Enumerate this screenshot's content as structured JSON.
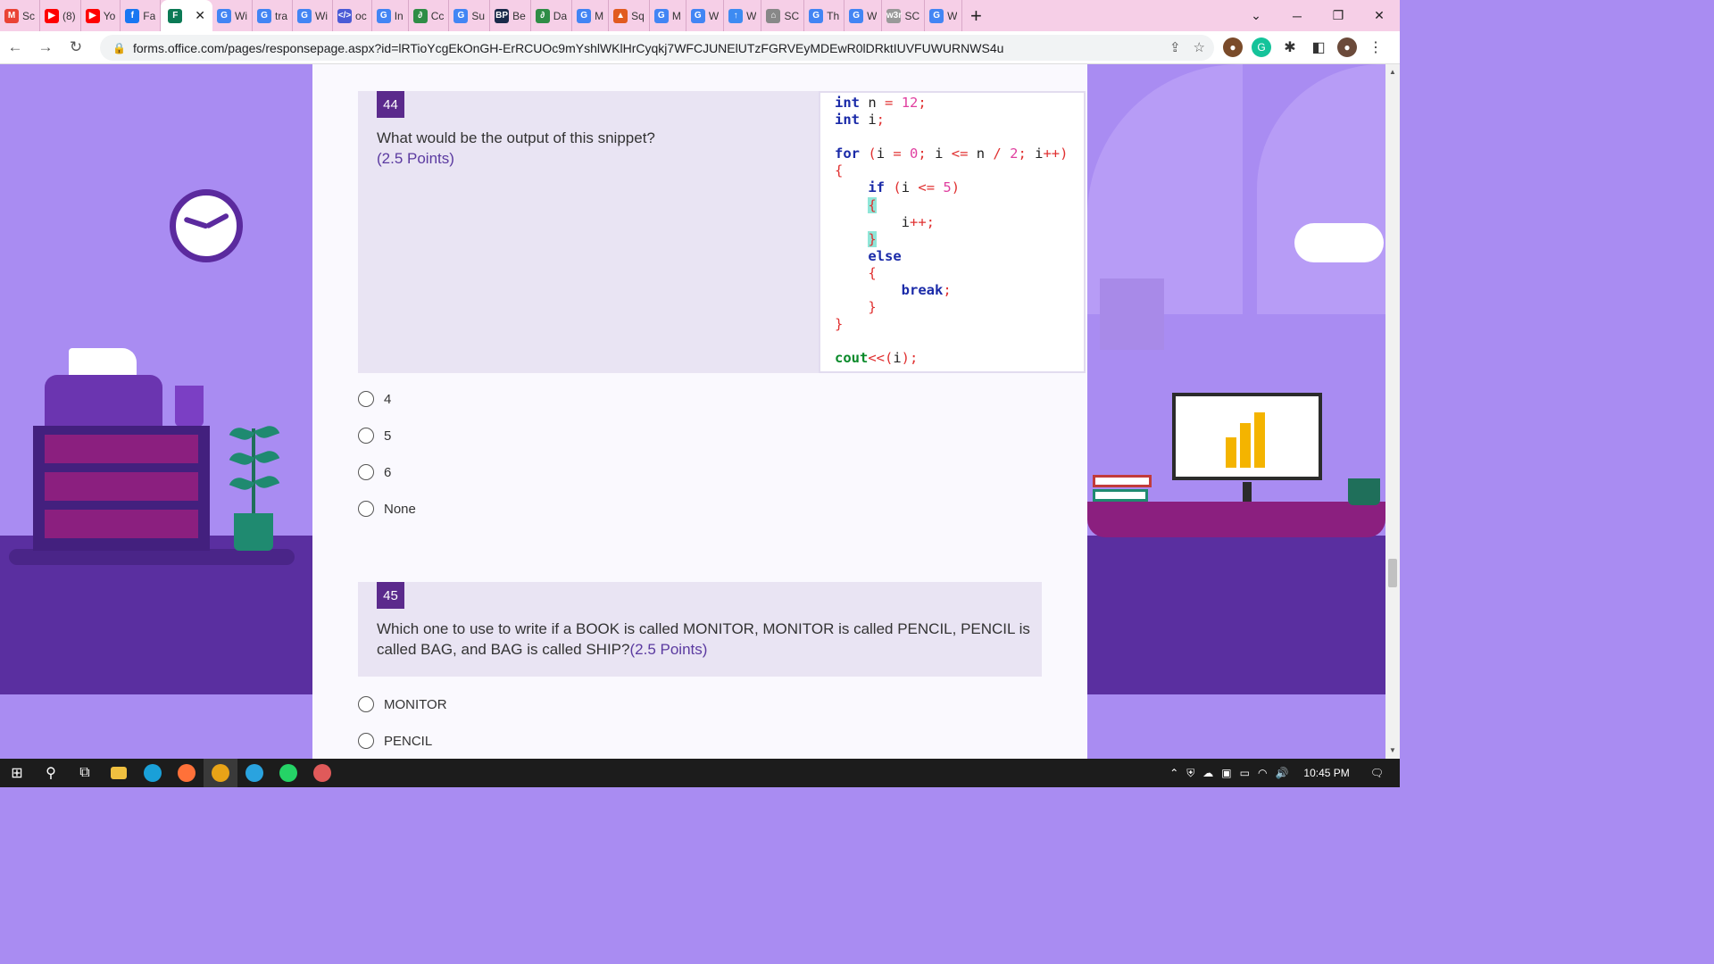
{
  "browser": {
    "tabs": [
      {
        "label": "Sc",
        "icon": "gmail-icon",
        "color": "#ea4335"
      },
      {
        "label": "(8)",
        "icon": "youtube-icon",
        "color": "#ff0000"
      },
      {
        "label": "Yo",
        "icon": "youtube-icon",
        "color": "#ff0000"
      },
      {
        "label": "Fa",
        "icon": "facebook-icon",
        "color": "#1877f2"
      },
      {
        "label": "",
        "icon": "forms-icon",
        "color": "#0b7a55",
        "active": true
      },
      {
        "label": "Wi",
        "icon": "google-icon",
        "color": "#4285f4"
      },
      {
        "label": "tra",
        "icon": "google-icon",
        "color": "#4285f4"
      },
      {
        "label": "Wi",
        "icon": "google-icon",
        "color": "#4285f4"
      },
      {
        "label": "oc",
        "icon": "code-icon",
        "color": "#4a5bd6"
      },
      {
        "label": "In",
        "icon": "google-icon",
        "color": "#4285f4"
      },
      {
        "label": "Cc",
        "icon": "geeks-icon",
        "color": "#2f8d46"
      },
      {
        "label": "Su",
        "icon": "google-icon",
        "color": "#4285f4"
      },
      {
        "label": "Be",
        "icon": "bp-icon",
        "color": "#1a2a4a"
      },
      {
        "label": "Da",
        "icon": "geeks-icon",
        "color": "#2f8d46"
      },
      {
        "label": "M",
        "icon": "google-icon",
        "color": "#4285f4"
      },
      {
        "label": "Sq",
        "icon": "matlab-icon",
        "color": "#e15b1f"
      },
      {
        "label": "M",
        "icon": "google-icon",
        "color": "#4285f4"
      },
      {
        "label": "W",
        "icon": "google-icon",
        "color": "#4285f4"
      },
      {
        "label": "W",
        "icon": "upload-icon",
        "color": "#3d8bf2"
      },
      {
        "label": "SC",
        "icon": "home-icon",
        "color": "#888888"
      },
      {
        "label": "Th",
        "icon": "google-icon",
        "color": "#4285f4"
      },
      {
        "label": "W",
        "icon": "google-icon",
        "color": "#4285f4"
      },
      {
        "label": "SC",
        "icon": "w3-icon",
        "color": "#999999"
      },
      {
        "label": "W",
        "icon": "google-icon",
        "color": "#4285f4"
      }
    ],
    "favicon_text": {
      "gmail": "M",
      "youtube": "▶",
      "facebook": "f",
      "forms": "F",
      "google": "G",
      "code": "</>",
      "geeks": "∂",
      "bp": "BP",
      "matlab": "▲",
      "upload": "↑",
      "home": "⌂",
      "w3": "w3r"
    },
    "url": "forms.office.com/pages/responsepage.aspx?id=lRTioYcgEkOnGH-ErRCUOc9mYshlWKlHrCyqkj7WFCJUNElUTzFGRVEyMDEwR0lDRktIUVFUWURNWS4u"
  },
  "form": {
    "q44": {
      "number": "44",
      "text": "What would be the output of this snippet?",
      "points": "(2.5 Points)",
      "options": [
        "4",
        "5",
        "6",
        "None"
      ]
    },
    "q45": {
      "number": "45",
      "text_line1": "Which one to use to write if a BOOK is called MONITOR, MONITOR is called PENCIL, PENCIL is",
      "text_line2": "called BAG, and BAG is called SHIP?",
      "points": "(2.5 Points)",
      "options": [
        "MONITOR",
        "PENCIL"
      ]
    }
  },
  "taskbar": {
    "time": "10:45 PM"
  },
  "colors": {
    "accent": "#5b2a8c",
    "background": "#a98cf2"
  }
}
